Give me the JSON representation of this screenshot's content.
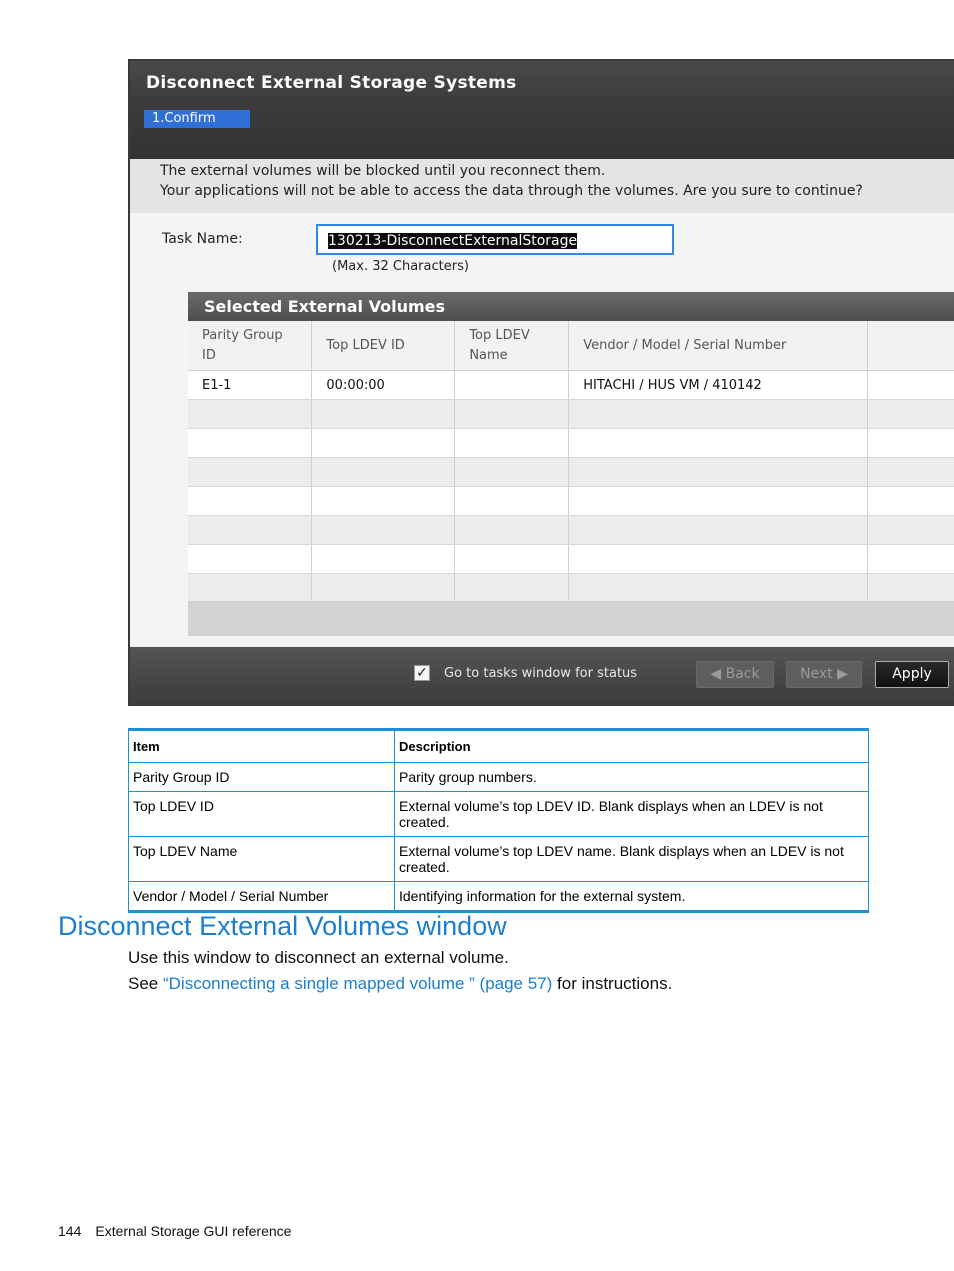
{
  "dialog": {
    "title": "Disconnect External Storage Systems",
    "step_tab": "1.Confirm",
    "message_line1": "The external volumes will be blocked until you reconnect them.",
    "message_line2": "Your applications will not be able to access the data through the volumes. Are you sure to continue?",
    "task_name_label": "Task Name:",
    "task_name_value": "130213-DisconnectExternalStorage",
    "task_name_hint": "(Max. 32 Characters)",
    "selected_volumes": {
      "title": "Selected External Volumes",
      "columns": [
        "Parity Group ID",
        "Top LDEV ID",
        "Top LDEV Name",
        "Vendor / Model / Serial Number",
        ""
      ],
      "rows": [
        [
          "E1-1",
          "00:00:00",
          "",
          "HITACHI / HUS VM / 410142",
          ""
        ]
      ]
    },
    "footer": {
      "checkbox_label": "Go to tasks window for status",
      "checkbox_checked": true,
      "back_label": "Back",
      "next_label": "Next",
      "apply_label": "Apply"
    }
  },
  "doc_table": {
    "headers": [
      "Item",
      "Description"
    ],
    "rows": [
      [
        "Parity Group ID",
        "Parity group numbers."
      ],
      [
        "Top LDEV ID",
        "External volume’s top LDEV ID. Blank displays when an LDEV is not created."
      ],
      [
        "Top LDEV Name",
        "External volume’s top LDEV name. Blank displays when an LDEV is not created."
      ],
      [
        "Vendor / Model / Serial Number",
        "Identifying information for the external system."
      ]
    ]
  },
  "section": {
    "title": "Disconnect External Volumes window",
    "para1": "Use this window to disconnect an external volume.",
    "para2_prefix": "See ",
    "para2_link": "“Disconnecting a single mapped volume ” (page 57)",
    "para2_suffix": " for instructions."
  },
  "page_footer": {
    "page_number": "144",
    "text": "External Storage GUI reference"
  }
}
